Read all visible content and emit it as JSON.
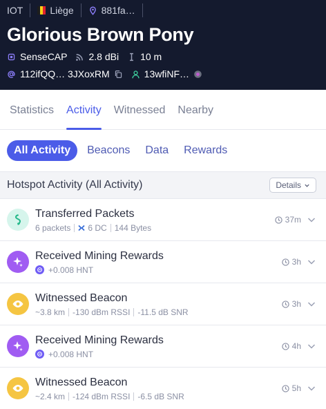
{
  "header": {
    "network": "IOT",
    "city": "Liège",
    "location": "881fa…",
    "name": "Glorious Brown Pony",
    "maker": "SenseCAP",
    "gain": "2.8 dBi",
    "elevation": "10 m",
    "owner": "112ifQQ… 3JXoxRM",
    "payer": "13wfiNF…"
  },
  "tabs": [
    {
      "label": "Statistics",
      "active": false
    },
    {
      "label": "Activity",
      "active": true
    },
    {
      "label": "Witnessed",
      "active": false
    },
    {
      "label": "Nearby",
      "active": false
    }
  ],
  "filters": [
    {
      "label": "All Activity",
      "active": true
    },
    {
      "label": "Beacons",
      "active": false
    },
    {
      "label": "Data",
      "active": false
    },
    {
      "label": "Rewards",
      "active": false
    }
  ],
  "section": {
    "title": "Hotspot Activity (All Activity)",
    "details_label": "Details"
  },
  "activities": [
    {
      "title": "Transferred Packets",
      "icon": "packets-icon",
      "sub": [
        "6 packets",
        "6 DC",
        "144 Bytes"
      ],
      "time": "37m"
    },
    {
      "title": "Received Mining Rewards",
      "icon": "sparkle-icon",
      "sub": [
        "+0.008 HNT"
      ],
      "time": "3h"
    },
    {
      "title": "Witnessed Beacon",
      "icon": "eye-icon",
      "sub": [
        "~3.8 km",
        "-130 dBm RSSI",
        "-11.5 dB SNR"
      ],
      "time": "3h"
    },
    {
      "title": "Received Mining Rewards",
      "icon": "sparkle-icon",
      "sub": [
        "+0.008 HNT"
      ],
      "time": "4h"
    },
    {
      "title": "Witnessed Beacon",
      "icon": "eye-icon",
      "sub": [
        "~2.4 km",
        "-124 dBm RSSI",
        "-6.5 dB SNR"
      ],
      "time": "5h"
    }
  ],
  "colors": {
    "header_bg": "#141a2e",
    "accent": "#4b5ce8",
    "packets_bg": "#d6f5ec",
    "rewards_bg": "#a05cf2",
    "beacon_bg": "#f5c542"
  }
}
